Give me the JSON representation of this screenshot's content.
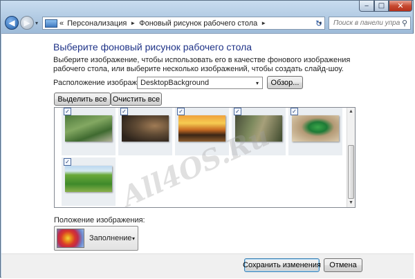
{
  "window": {
    "min_glyph": "‒",
    "max_glyph": "□",
    "close_glyph": "✕"
  },
  "nav": {
    "back_glyph": "◀",
    "forward_glyph": "▶",
    "history_glyph": "▾",
    "breadcrumb_prefix": "«",
    "breadcrumb": [
      "Персонализация",
      "Фоновый рисунок рабочего стола"
    ],
    "separator_glyph": "►",
    "address_dropdown_glyph": "▾",
    "refresh_glyph": "↻",
    "search_placeholder": "Поиск в панели управл...",
    "search_icon": "search-icon",
    "search_glyph": "⚲"
  },
  "main": {
    "title": "Выберите фоновый рисунок рабочего стола",
    "description": "Выберите изображение, чтобы использовать его в качестве фонового изображения рабочего стола, или выберите несколько изображений, чтобы создать слайд-шоу.",
    "location_label": "Расположение изображения:",
    "location_value": "DesktopBackground",
    "dropdown_glyph": "▾",
    "browse_label": "Обзор...",
    "select_all_label": "Выделить все",
    "clear_all_label": "Очистить все",
    "check_glyph": "✓",
    "images": [
      {
        "name": "heron",
        "checked": true
      },
      {
        "name": "cave",
        "checked": true
      },
      {
        "name": "sunset-rocks",
        "checked": true
      },
      {
        "name": "forest-cliffs",
        "checked": true
      },
      {
        "name": "green-snake",
        "checked": true
      },
      {
        "name": "field-path",
        "checked": true
      }
    ],
    "scroll_up_glyph": "▲",
    "scroll_down_glyph": "▼",
    "position_label": "Положение изображения:",
    "position_value": "Заполнение"
  },
  "footer": {
    "save_label": "Сохранить изменения",
    "cancel_label": "Отмена"
  },
  "watermark": "All4OS.Ru"
}
